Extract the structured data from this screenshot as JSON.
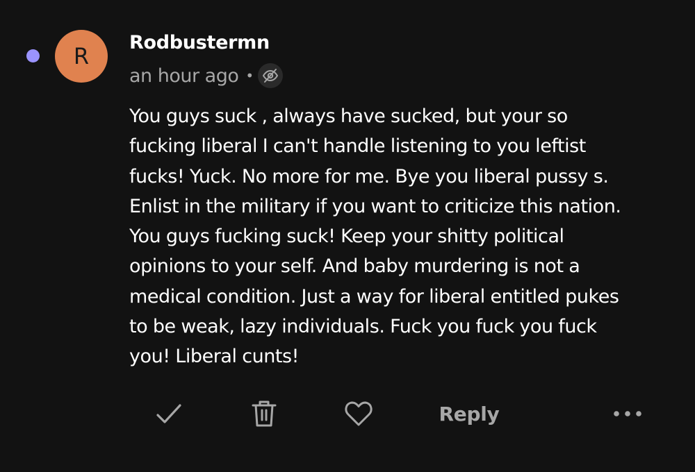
{
  "colors": {
    "background": "#121212",
    "unread_dot": "#9a93ff",
    "avatar_bg": "#e0824f",
    "text_primary": "#ffffff",
    "text_secondary": "#a7a7a7"
  },
  "comment": {
    "unread_indicator": "unread-dot",
    "avatar_initial": "R",
    "username": "Rodbustermn",
    "timestamp": "an hour ago",
    "separator": "•",
    "visibility_icon": "eye-slash-icon",
    "body": "You guys suck , always have sucked, but your so\nfucking liberal I can't handle listening to you leftist\nfucks! Yuck. No more for me. Bye you liberal pussy s.\nEnlist in the military if you want to criticize this nation.\nYou guys fucking suck! Keep your shitty political\nopinions to your self.  And baby murdering is not a\nmedical condition. Just a way for liberal entitled pukes\nto be weak, lazy individuals. Fuck you fuck you fuck\nyou! Liberal cunts!"
  },
  "actions": {
    "approve_icon": "checkmark-icon",
    "delete_icon": "trash-icon",
    "like_icon": "heart-icon",
    "reply_label": "Reply",
    "more_icon": "more-horizontal-icon"
  }
}
